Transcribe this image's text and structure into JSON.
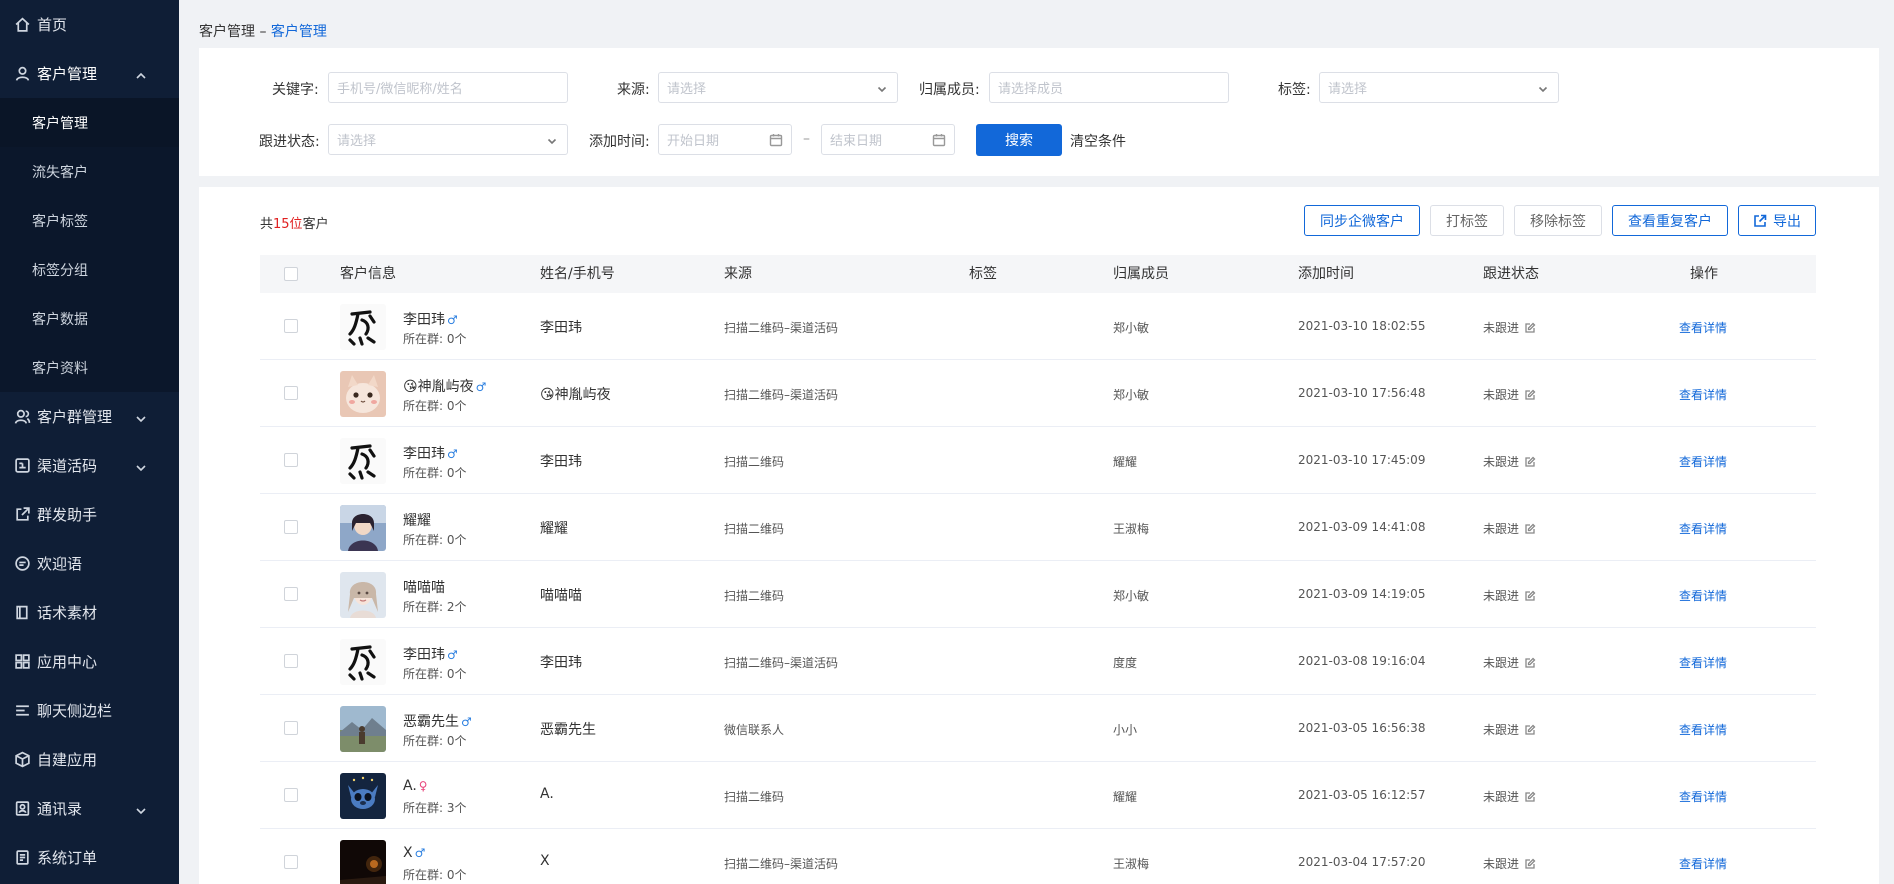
{
  "sidebar": {
    "items": [
      {
        "label": "首页",
        "icon": "home-icon"
      },
      {
        "label": "客户管理",
        "icon": "user-icon",
        "expanded": true
      },
      {
        "label": "客户群管理",
        "icon": "group-icon"
      },
      {
        "label": "渠道活码",
        "icon": "qrcode-icon"
      },
      {
        "label": "群发助手",
        "icon": "share-icon"
      },
      {
        "label": "欢迎语",
        "icon": "chat-icon"
      },
      {
        "label": "话术素材",
        "icon": "book-icon"
      },
      {
        "label": "应用中心",
        "icon": "apps-icon"
      },
      {
        "label": "聊天侧边栏",
        "icon": "list-icon"
      },
      {
        "label": "自建应用",
        "icon": "cube-icon"
      },
      {
        "label": "通讯录",
        "icon": "contacts-icon"
      },
      {
        "label": "系统订单",
        "icon": "order-icon"
      }
    ],
    "sub_items": [
      "客户管理",
      "流失客户",
      "客户标签",
      "标签分组",
      "客户数据",
      "客户资料"
    ]
  },
  "breadcrumb": {
    "parent": "客户管理",
    "separator": "–",
    "current": "客户管理"
  },
  "filters": {
    "keyword_label": "关键字:",
    "keyword_placeholder": "手机号/微信昵称/姓名",
    "source_label": "来源:",
    "source_placeholder": "请选择",
    "member_label": "归属成员:",
    "member_placeholder": "请选择成员",
    "tag_label": "标签:",
    "tag_placeholder": "请选择",
    "status_label": "跟进状态:",
    "status_placeholder": "请选择",
    "time_label": "添加时间:",
    "start_placeholder": "开始日期",
    "range_sep": "–",
    "end_placeholder": "结束日期",
    "search_btn": "搜索",
    "clear_btn": "清空条件"
  },
  "summary": {
    "prefix": "共",
    "count": "15位",
    "suffix": "客户"
  },
  "toolbar": {
    "sync": "同步企微客户",
    "tag": "打标签",
    "remove_tag": "移除标签",
    "duplicates": "查看重复客户",
    "export": "导出"
  },
  "table": {
    "headers": {
      "info": "客户信息",
      "name": "姓名/手机号",
      "source": "来源",
      "tag": "标签",
      "owner": "归属成员",
      "time": "添加时间",
      "status": "跟进状态",
      "op": "操作"
    },
    "rows": [
      {
        "nick": "李田玮",
        "gender": "♂",
        "gender_type": "m",
        "groups": "所在群: 0个",
        "name": "李田玮",
        "source": "扫描二维码–渠道活码",
        "owner": "郑小敏",
        "time": "2021-03-10 18:02:55",
        "status": "未跟进",
        "op": "查看详情",
        "avatar": "calligraphy"
      },
      {
        "nick": "😘神胤屿夜",
        "gender": "♂",
        "gender_type": "m",
        "groups": "所在群: 0个",
        "name": "😘神胤屿夜",
        "source": "扫描二维码–渠道活码",
        "owner": "郑小敏",
        "time": "2021-03-10 17:56:48",
        "status": "未跟进",
        "op": "查看详情",
        "avatar": "cat"
      },
      {
        "nick": "李田玮",
        "gender": "♂",
        "gender_type": "m",
        "groups": "所在群: 0个",
        "name": "李田玮",
        "source": "扫描二维码",
        "owner": "耀耀",
        "time": "2021-03-10 17:45:09",
        "status": "未跟进",
        "op": "查看详情",
        "avatar": "calligraphy"
      },
      {
        "nick": "耀耀",
        "gender": "",
        "gender_type": "",
        "groups": "所在群: 0个",
        "name": "耀耀",
        "source": "扫描二维码",
        "owner": "王淑梅",
        "time": "2021-03-09 14:41:08",
        "status": "未跟进",
        "op": "查看详情",
        "avatar": "portrait1"
      },
      {
        "nick": "喵喵喵",
        "gender": "",
        "gender_type": "",
        "groups": "所在群: 2个",
        "name": "喵喵喵",
        "source": "扫描二维码",
        "owner": "郑小敏",
        "time": "2021-03-09 14:19:05",
        "status": "未跟进",
        "op": "查看详情",
        "avatar": "portrait2"
      },
      {
        "nick": "李田玮",
        "gender": "♂",
        "gender_type": "m",
        "groups": "所在群: 0个",
        "name": "李田玮",
        "source": "扫描二维码–渠道活码",
        "owner": "度度",
        "time": "2021-03-08 19:16:04",
        "status": "未跟进",
        "op": "查看详情",
        "avatar": "calligraphy"
      },
      {
        "nick": "恶霸先生",
        "gender": "♂",
        "gender_type": "m",
        "groups": "所在群: 0个",
        "name": "恶霸先生",
        "source": "微信联系人",
        "owner": "小小",
        "time": "2021-03-05 16:56:38",
        "status": "未跟进",
        "op": "查看详情",
        "avatar": "landscape"
      },
      {
        "nick": "A.",
        "gender": "♀",
        "gender_type": "f",
        "groups": "所在群: 3个",
        "name": "A.",
        "source": "扫描二维码",
        "owner": "耀耀",
        "time": "2021-03-05 16:12:57",
        "status": "未跟进",
        "op": "查看详情",
        "avatar": "stitch"
      },
      {
        "nick": "X",
        "gender": "♂",
        "gender_type": "m",
        "groups": "所在群: 0个",
        "name": "X",
        "source": "扫描二维码–渠道活码",
        "owner": "王淑梅",
        "time": "2021-03-04 17:57:20",
        "status": "未跟进",
        "op": "查看详情",
        "avatar": "dark"
      }
    ]
  },
  "colors": {
    "primary": "#1268d9",
    "sidebar": "#0f1e36",
    "danger": "#e02020"
  }
}
